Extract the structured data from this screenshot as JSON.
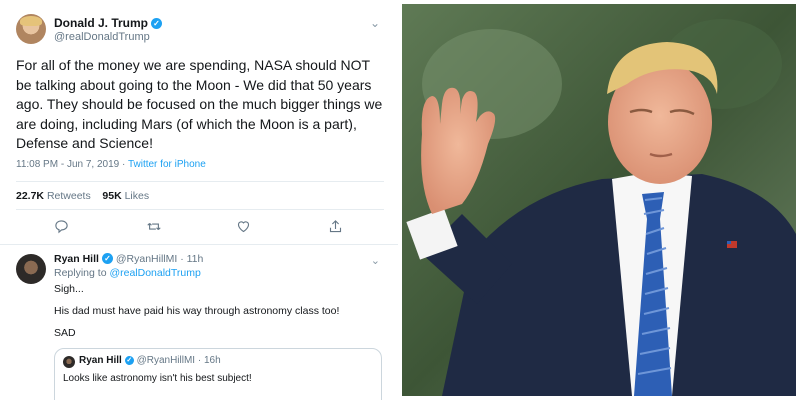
{
  "tweet": {
    "author_name": "Donald J. Trump",
    "author_handle": "@realDonaldTrump",
    "verified_mark": "✓",
    "text": "For all of the money we are spending, NASA should NOT be talking about going to the Moon - We did that 50 years ago. They should be focused on the much bigger things we are doing, including Mars (of which the Moon is a part), Defense and Science!",
    "time": "11:08 PM - Jun 7, 2019",
    "separator": " · ",
    "source": "Twitter for iPhone",
    "retweets_count": "22.7K",
    "retweets_label": "Retweets",
    "likes_count": "95K",
    "likes_label": "Likes"
  },
  "reply": {
    "author_name": "Ryan Hill",
    "author_handle": "@RyanHillMI",
    "time": "· 11h",
    "replying_prefix": "Replying to",
    "replying_to": "@realDonaldTrump",
    "lines": [
      "Sigh...",
      "His dad must have paid his way through astronomy class too!",
      "SAD"
    ]
  },
  "quoted": {
    "author_name": "Ryan Hill",
    "author_handle": "@RyanHillMI",
    "time": "· 16h",
    "text": "Looks like astronomy isn't his best subject!"
  },
  "icons": [
    "chevron-down-icon",
    "verified-icon",
    "reply-icon",
    "retweet-icon",
    "like-icon",
    "share-icon"
  ],
  "colors": {
    "twitter_blue": "#1da1f2",
    "gray_text": "#657786",
    "suit_navy": "#1f2a44",
    "tie_blue": "#2d5fb5"
  }
}
